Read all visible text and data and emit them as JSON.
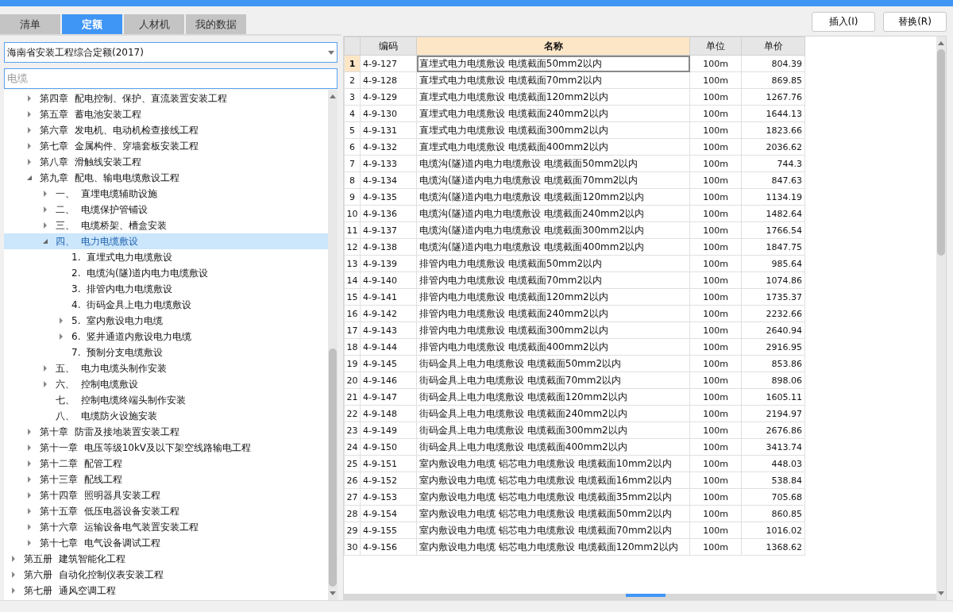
{
  "tabs": [
    {
      "label": "清单",
      "selected": false
    },
    {
      "label": "定额",
      "selected": true
    },
    {
      "label": "人材机",
      "selected": false
    },
    {
      "label": "我的数据",
      "selected": false
    }
  ],
  "library_select": {
    "value": "海南省安装工程综合定额(2017)"
  },
  "search": {
    "value": "电缆"
  },
  "tree": {
    "items": [
      {
        "children": [
          {
            "label": "第四章  配电控制、保护、直流装置安装工程",
            "expanded": false,
            "selected": false
          },
          {
            "label": "第五章  蓄电池安装工程",
            "expanded": false,
            "selected": false
          },
          {
            "label": "第六章  发电机、电动机检查接线工程",
            "expanded": false,
            "selected": false
          },
          {
            "label": "第七章  金属构件、穿墙套板安装工程",
            "expanded": false,
            "selected": false
          },
          {
            "label": "第八章  滑触线安装工程",
            "expanded": false,
            "selected": false
          },
          {
            "label": "第九章  配电、输电电缆敷设工程",
            "expanded": true,
            "selected": false,
            "children": [
              {
                "label": "一、  直埋电缆辅助设施",
                "expanded": false,
                "selected": false
              },
              {
                "label": "二、  电缆保护管铺设",
                "expanded": false,
                "selected": false
              },
              {
                "label": "三、  电缆桥架、槽盒安装",
                "expanded": false,
                "selected": false
              },
              {
                "label": "四、  电力电缆敷设",
                "expanded": true,
                "selected": true,
                "children": [
                  {
                    "label": "1.  直埋式电力电缆敷设",
                    "selected": false
                  },
                  {
                    "label": "2.  电缆沟(隧)道内电力电缆敷设",
                    "selected": false
                  },
                  {
                    "label": "3.  排管内电力电缆敷设",
                    "selected": false
                  },
                  {
                    "label": "4.  街码金具上电力电缆敷设",
                    "selected": false
                  },
                  {
                    "label": "5.  室内敷设电力电缆",
                    "expanded": false,
                    "selected": false
                  },
                  {
                    "label": "6.  竖井通道内敷设电力电缆",
                    "expanded": false,
                    "selected": false
                  },
                  {
                    "label": "7.  预制分支电缆敷设",
                    "selected": false
                  }
                ]
              },
              {
                "label": "五、  电力电缆头制作安装",
                "expanded": false,
                "selected": false
              },
              {
                "label": "六、  控制电缆敷设",
                "expanded": false,
                "selected": false
              },
              {
                "label": "七、  控制电缆终端头制作安装",
                "selected": false
              },
              {
                "label": "八、  电缆防火设施安装",
                "selected": false
              }
            ]
          },
          {
            "label": "第十章  防雷及接地装置安装工程",
            "expanded": false,
            "selected": false
          },
          {
            "label": "第十一章  电压等级10kV及以下架空线路输电工程",
            "expanded": false,
            "selected": false
          },
          {
            "label": "第十二章  配管工程",
            "expanded": false,
            "selected": false
          },
          {
            "label": "第十三章  配线工程",
            "expanded": false,
            "selected": false
          },
          {
            "label": "第十四章  照明器具安装工程",
            "expanded": false,
            "selected": false
          },
          {
            "label": "第十五章  低压电器设备安装工程",
            "expanded": false,
            "selected": false
          },
          {
            "label": "第十六章  运输设备电气装置安装工程",
            "expanded": false,
            "selected": false
          },
          {
            "label": "第十七章  电气设备调试工程",
            "expanded": false,
            "selected": false
          }
        ]
      },
      {
        "label": "第五册  建筑智能化工程",
        "expanded": false,
        "selected": false
      },
      {
        "label": "第六册  自动化控制仪表安装工程",
        "expanded": false,
        "selected": false
      },
      {
        "label": "第七册  通风空调工程",
        "expanded": false,
        "selected": false
      }
    ]
  },
  "buttons": [
    "插入(I)",
    "替换(R)"
  ],
  "table": {
    "columns": [
      {
        "label": "编码",
        "selected": false
      },
      {
        "label": "名称",
        "selected": true
      },
      {
        "label": "单位",
        "selected": false
      },
      {
        "label": "单价",
        "selected": false
      }
    ],
    "rows": [
      {
        "no": "1",
        "code": "4-9-127",
        "name": "直埋式电力电缆敷设 电缆截面50mm2以内",
        "unit": "100m",
        "price": "804.39",
        "selected": true
      },
      {
        "no": "2",
        "code": "4-9-128",
        "name": "直埋式电力电缆敷设 电缆截面70mm2以内",
        "unit": "100m",
        "price": "869.85",
        "selected": false
      },
      {
        "no": "3",
        "code": "4-9-129",
        "name": "直埋式电力电缆敷设 电缆截面120mm2以内",
        "unit": "100m",
        "price": "1267.76",
        "selected": false
      },
      {
        "no": "4",
        "code": "4-9-130",
        "name": "直埋式电力电缆敷设 电缆截面240mm2以内",
        "unit": "100m",
        "price": "1644.13",
        "selected": false
      },
      {
        "no": "5",
        "code": "4-9-131",
        "name": "直埋式电力电缆敷设 电缆截面300mm2以内",
        "unit": "100m",
        "price": "1823.66",
        "selected": false
      },
      {
        "no": "6",
        "code": "4-9-132",
        "name": "直埋式电力电缆敷设 电缆截面400mm2以内",
        "unit": "100m",
        "price": "2036.62",
        "selected": false
      },
      {
        "no": "7",
        "code": "4-9-133",
        "name": "电缆沟(隧)道内电力电缆敷设 电缆截面50mm2以内",
        "unit": "100m",
        "price": "744.3",
        "selected": false
      },
      {
        "no": "8",
        "code": "4-9-134",
        "name": "电缆沟(隧)道内电力电缆敷设 电缆截面70mm2以内",
        "unit": "100m",
        "price": "847.63",
        "selected": false
      },
      {
        "no": "9",
        "code": "4-9-135",
        "name": "电缆沟(隧)道内电力电缆敷设 电缆截面120mm2以内",
        "unit": "100m",
        "price": "1134.19",
        "selected": false
      },
      {
        "no": "10",
        "code": "4-9-136",
        "name": "电缆沟(隧)道内电力电缆敷设 电缆截面240mm2以内",
        "unit": "100m",
        "price": "1482.64",
        "selected": false
      },
      {
        "no": "11",
        "code": "4-9-137",
        "name": "电缆沟(隧)道内电力电缆敷设 电缆截面300mm2以内",
        "unit": "100m",
        "price": "1766.54",
        "selected": false
      },
      {
        "no": "12",
        "code": "4-9-138",
        "name": "电缆沟(隧)道内电力电缆敷设 电缆截面400mm2以内",
        "unit": "100m",
        "price": "1847.75",
        "selected": false
      },
      {
        "no": "13",
        "code": "4-9-139",
        "name": "排管内电力电缆敷设 电缆截面50mm2以内",
        "unit": "100m",
        "price": "985.64",
        "selected": false
      },
      {
        "no": "14",
        "code": "4-9-140",
        "name": "排管内电力电缆敷设 电缆截面70mm2以内",
        "unit": "100m",
        "price": "1074.86",
        "selected": false
      },
      {
        "no": "15",
        "code": "4-9-141",
        "name": "排管内电力电缆敷设 电缆截面120mm2以内",
        "unit": "100m",
        "price": "1735.37",
        "selected": false
      },
      {
        "no": "16",
        "code": "4-9-142",
        "name": "排管内电力电缆敷设 电缆截面240mm2以内",
        "unit": "100m",
        "price": "2232.66",
        "selected": false
      },
      {
        "no": "17",
        "code": "4-9-143",
        "name": "排管内电力电缆敷设 电缆截面300mm2以内",
        "unit": "100m",
        "price": "2640.94",
        "selected": false
      },
      {
        "no": "18",
        "code": "4-9-144",
        "name": "排管内电力电缆敷设 电缆截面400mm2以内",
        "unit": "100m",
        "price": "2916.95",
        "selected": false
      },
      {
        "no": "19",
        "code": "4-9-145",
        "name": "街码金具上电力电缆敷设 电缆截面50mm2以内",
        "unit": "100m",
        "price": "853.86",
        "selected": false
      },
      {
        "no": "20",
        "code": "4-9-146",
        "name": "街码金具上电力电缆敷设 电缆截面70mm2以内",
        "unit": "100m",
        "price": "898.06",
        "selected": false
      },
      {
        "no": "21",
        "code": "4-9-147",
        "name": "街码金具上电力电缆敷设 电缆截面120mm2以内",
        "unit": "100m",
        "price": "1605.11",
        "selected": false
      },
      {
        "no": "22",
        "code": "4-9-148",
        "name": "街码金具上电力电缆敷设 电缆截面240mm2以内",
        "unit": "100m",
        "price": "2194.97",
        "selected": false
      },
      {
        "no": "23",
        "code": "4-9-149",
        "name": "街码金具上电力电缆敷设 电缆截面300mm2以内",
        "unit": "100m",
        "price": "2676.86",
        "selected": false
      },
      {
        "no": "24",
        "code": "4-9-150",
        "name": "街码金具上电力电缆敷设 电缆截面400mm2以内",
        "unit": "100m",
        "price": "3413.74",
        "selected": false
      },
      {
        "no": "25",
        "code": "4-9-151",
        "name": "室内敷设电力电缆 铝芯电力电缆敷设 电缆截面10mm2以内",
        "unit": "100m",
        "price": "448.03",
        "selected": false
      },
      {
        "no": "26",
        "code": "4-9-152",
        "name": "室内敷设电力电缆 铝芯电力电缆敷设 电缆截面16mm2以内",
        "unit": "100m",
        "price": "538.84",
        "selected": false
      },
      {
        "no": "27",
        "code": "4-9-153",
        "name": "室内敷设电力电缆 铝芯电力电缆敷设 电缆截面35mm2以内",
        "unit": "100m",
        "price": "705.68",
        "selected": false
      },
      {
        "no": "28",
        "code": "4-9-154",
        "name": "室内敷设电力电缆 铝芯电力电缆敷设 电缆截面50mm2以内",
        "unit": "100m",
        "price": "860.85",
        "selected": false
      },
      {
        "no": "29",
        "code": "4-9-155",
        "name": "室内敷设电力电缆 铝芯电力电缆敷设 电缆截面70mm2以内",
        "unit": "100m",
        "price": "1016.02",
        "selected": false
      },
      {
        "no": "30",
        "code": "4-9-156",
        "name": "室内敷设电力电缆 铝芯电力电缆敷设 电缆截面120mm2以内",
        "unit": "100m",
        "price": "1368.62",
        "selected": false
      }
    ]
  }
}
